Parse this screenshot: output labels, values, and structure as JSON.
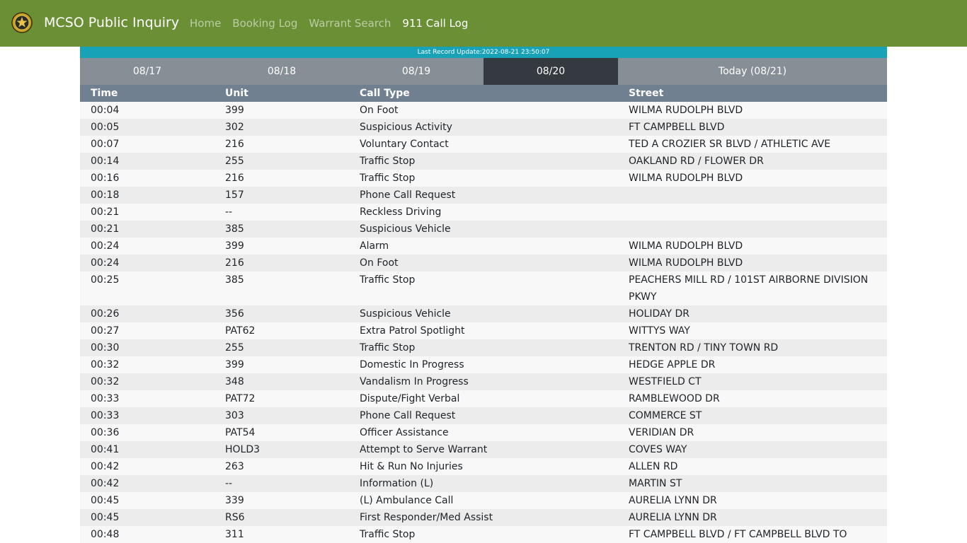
{
  "app": {
    "brand": "MCSO Public Inquiry",
    "nav": [
      {
        "label": "Home"
      },
      {
        "label": "Booking Log"
      },
      {
        "label": "Warrant Search"
      },
      {
        "label": "911 Call Log"
      }
    ],
    "active_nav_index": 3,
    "colors": {
      "navbar": "#6a8f35",
      "update_bar": "#17a2b8",
      "tab": "#868e96",
      "tab_active": "#343a40",
      "table_header": "#708090"
    }
  },
  "update": {
    "text": "Last Record Update:2022-08-21 23:50:07"
  },
  "tabs": [
    {
      "label": "08/17"
    },
    {
      "label": "08/18"
    },
    {
      "label": "08/19"
    },
    {
      "label": "08/20"
    },
    {
      "label": "Today (08/21)"
    }
  ],
  "active_tab_index": 3,
  "table": {
    "headers": {
      "time": "Time",
      "unit": "Unit",
      "call_type": "Call Type",
      "street": "Street"
    },
    "rows": [
      {
        "time": "00:04",
        "unit": "399",
        "call_type": "On Foot",
        "street": "WILMA RUDOLPH BLVD"
      },
      {
        "time": "00:05",
        "unit": "302",
        "call_type": "Suspicious Activity",
        "street": "FT CAMPBELL BLVD"
      },
      {
        "time": "00:07",
        "unit": "216",
        "call_type": "Voluntary Contact",
        "street": "TED A CROZIER SR BLVD / ATHLETIC AVE"
      },
      {
        "time": "00:14",
        "unit": "255",
        "call_type": "Traffic Stop",
        "street": "OAKLAND RD / FLOWER DR"
      },
      {
        "time": "00:16",
        "unit": "216",
        "call_type": "Traffic Stop",
        "street": "WILMA RUDOLPH BLVD"
      },
      {
        "time": "00:18",
        "unit": "157",
        "call_type": "Phone Call Request",
        "street": ""
      },
      {
        "time": "00:21",
        "unit": "--",
        "call_type": "Reckless Driving",
        "street": ""
      },
      {
        "time": "00:21",
        "unit": "385",
        "call_type": "Suspicious Vehicle",
        "street": ""
      },
      {
        "time": "00:24",
        "unit": "399",
        "call_type": "Alarm",
        "street": "WILMA RUDOLPH BLVD"
      },
      {
        "time": "00:24",
        "unit": "216",
        "call_type": "On Foot",
        "street": "WILMA RUDOLPH BLVD"
      },
      {
        "time": "00:25",
        "unit": "385",
        "call_type": "Traffic Stop",
        "street": "PEACHERS MILL RD / 101ST AIRBORNE DIVISION PKWY"
      },
      {
        "time": "00:26",
        "unit": "356",
        "call_type": "Suspicious Vehicle",
        "street": "HOLIDAY DR"
      },
      {
        "time": "00:27",
        "unit": "PAT62",
        "call_type": "Extra Patrol Spotlight",
        "street": "WITTYS WAY"
      },
      {
        "time": "00:30",
        "unit": "255",
        "call_type": "Traffic Stop",
        "street": "TRENTON RD / TINY TOWN RD"
      },
      {
        "time": "00:32",
        "unit": "399",
        "call_type": "Domestic In Progress",
        "street": "HEDGE APPLE DR"
      },
      {
        "time": "00:32",
        "unit": "348",
        "call_type": "Vandalism In Progress",
        "street": "WESTFIELD CT"
      },
      {
        "time": "00:33",
        "unit": "PAT72",
        "call_type": "Dispute/Fight Verbal",
        "street": "RAMBLEWOOD DR"
      },
      {
        "time": "00:33",
        "unit": "303",
        "call_type": "Phone Call Request",
        "street": "COMMERCE ST"
      },
      {
        "time": "00:36",
        "unit": "PAT54",
        "call_type": "Officer Assistance",
        "street": "VERIDIAN DR"
      },
      {
        "time": "00:41",
        "unit": "HOLD3",
        "call_type": "Attempt to Serve Warrant",
        "street": "COVES WAY"
      },
      {
        "time": "00:42",
        "unit": "263",
        "call_type": "Hit & Run No Injuries",
        "street": "ALLEN RD"
      },
      {
        "time": "00:42",
        "unit": "--",
        "call_type": "Information (L)",
        "street": "MARTIN ST"
      },
      {
        "time": "00:45",
        "unit": "339",
        "call_type": "(L) Ambulance Call",
        "street": "AURELIA LYNN DR"
      },
      {
        "time": "00:45",
        "unit": "RS6",
        "call_type": "First Responder/Med Assist",
        "street": "AURELIA LYNN DR"
      },
      {
        "time": "00:48",
        "unit": "311",
        "call_type": "Traffic Stop",
        "street": "FT CAMPBELL BLVD / FT CAMPBELL BLVD TO"
      }
    ]
  }
}
